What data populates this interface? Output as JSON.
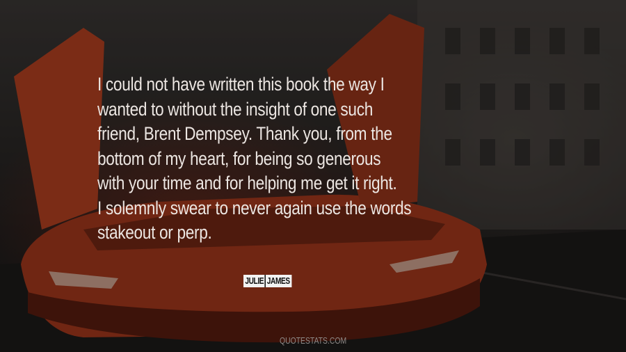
{
  "quote": {
    "lines": [
      "I could not have written this book the way I",
      "wanted to without the insight of one such",
      "friend, Brent Dempsey. Thank you, from the",
      "bottom of my heart, for being so generous",
      "with your time and for helping me get it right.",
      "I solemnly swear to never again use the words",
      "stakeout or perp."
    ]
  },
  "author": {
    "first": "JULIE",
    "last": "JAMES"
  },
  "site": {
    "name": "QUOTESTATS.COM"
  },
  "colors": {
    "text": "#ece6e2",
    "car": "#c0401f",
    "badge": "#f2f2f2"
  }
}
